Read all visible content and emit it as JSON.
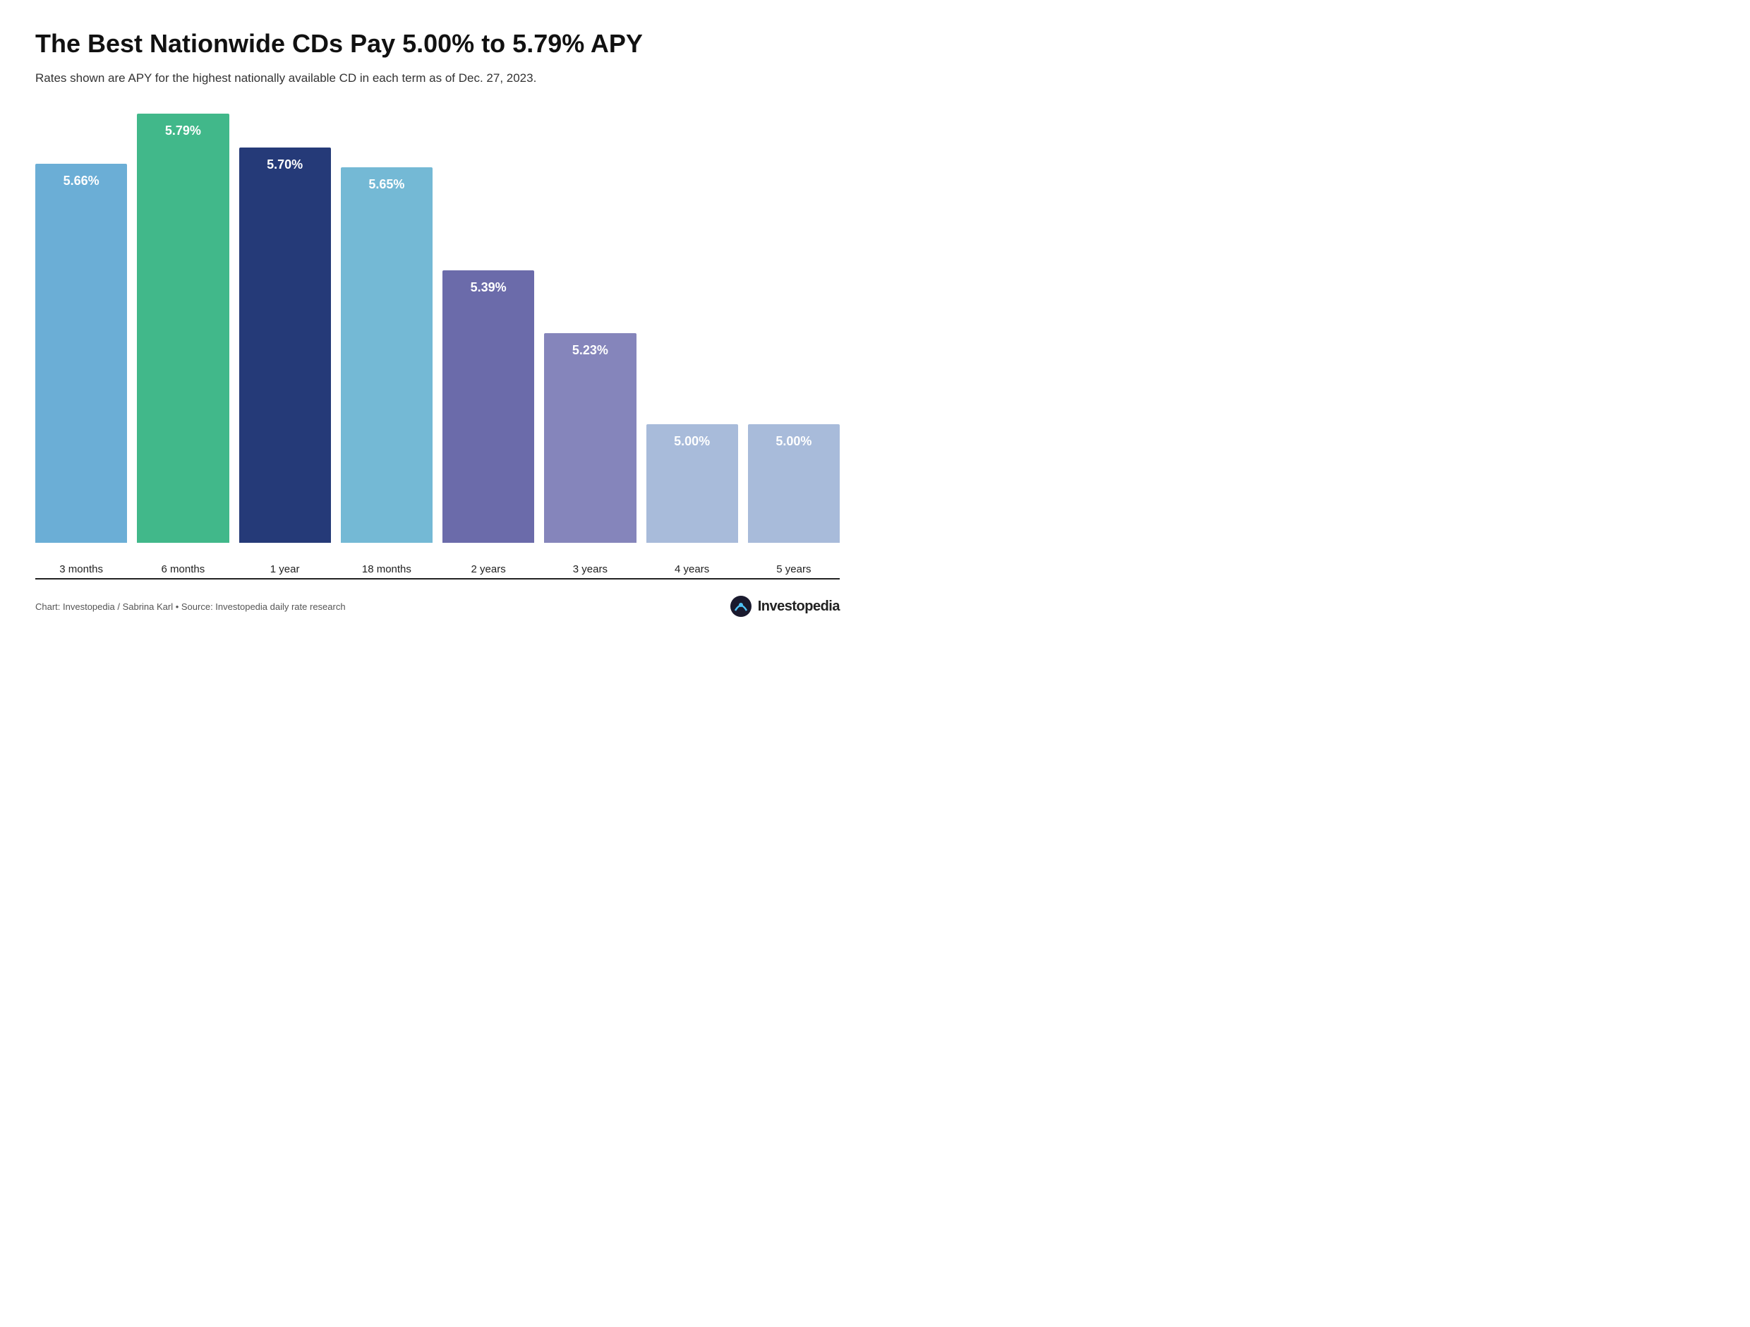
{
  "title": "The Best Nationwide CDs Pay 5.00% to 5.79% APY",
  "subtitle": "Rates shown are APY for the highest nationally available CD in each term as of Dec. 27, 2023.",
  "footer": {
    "credit": "Chart: Investopedia / Sabrina Karl • Source: Investopedia daily rate research"
  },
  "logo": {
    "text": "Investopedia"
  },
  "chart": {
    "max_value": 5.79,
    "min_display": 4.85,
    "bars": [
      {
        "label": "3 months",
        "value": 5.66,
        "display": "5.66%",
        "color": "#6BAED6"
      },
      {
        "label": "6 months",
        "value": 5.79,
        "display": "5.79%",
        "color": "#41B88A"
      },
      {
        "label": "1 year",
        "value": 5.7,
        "display": "5.70%",
        "color": "#253A78"
      },
      {
        "label": "18 months",
        "value": 5.65,
        "display": "5.65%",
        "color": "#74B9D5"
      },
      {
        "label": "2 years",
        "value": 5.39,
        "display": "5.39%",
        "color": "#6B6BAA"
      },
      {
        "label": "3 years",
        "value": 5.23,
        "display": "5.23%",
        "color": "#8585BB"
      },
      {
        "label": "4 years",
        "value": 5.0,
        "display": "5.00%",
        "color": "#A8BBDA"
      },
      {
        "label": "5 years",
        "value": 5.0,
        "display": "5.00%",
        "color": "#A8BBDA"
      }
    ]
  }
}
